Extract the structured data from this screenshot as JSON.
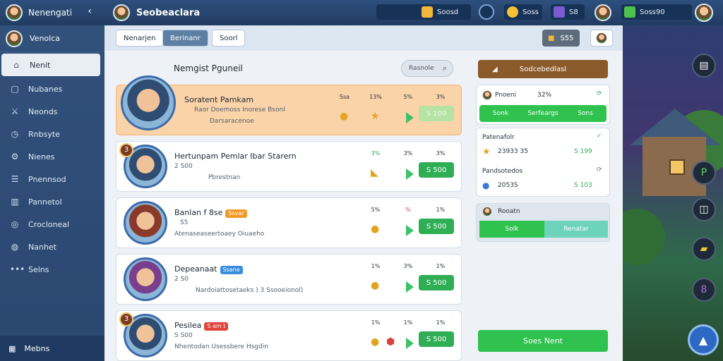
{
  "top": {
    "brand": "Nenengati",
    "collapse": "‹",
    "title": "Seobeaclara",
    "res1": "Soosd",
    "res2": "Soss",
    "res3": "S8",
    "res4": "Soss90"
  },
  "sidebar": {
    "profile": "Venolca",
    "items": [
      {
        "label": "Nenit",
        "icon": "home-icon"
      },
      {
        "label": "Nubanes",
        "icon": "document-icon"
      },
      {
        "label": "Neonds",
        "icon": "sword-icon"
      },
      {
        "label": "Rnbsyte",
        "icon": "clock-icon"
      },
      {
        "label": "Nienes",
        "icon": "cog-icon"
      },
      {
        "label": "Pnennsod",
        "icon": "list-icon"
      },
      {
        "label": "Pannetol",
        "icon": "book-icon"
      },
      {
        "label": "Crocloneal",
        "icon": "stack-icon"
      },
      {
        "label": "Nanhet",
        "icon": "globe-icon"
      },
      {
        "label": "Selns",
        "icon": "more-icon"
      }
    ],
    "bottom": "Mebns"
  },
  "tabs": [
    "Nenarjen",
    "Berinanr",
    "Soorl"
  ],
  "tab_stat": "S55",
  "list": {
    "title": "Nemgist Pguneil",
    "search": "Rasnole"
  },
  "players": [
    {
      "name": "Soratent Pamkam",
      "rank": "",
      "level": "Raor Doemoss Inorese Bsonl",
      "desc": "Darsaracenoe",
      "stats": [
        "Ssa",
        "13%",
        "5%",
        "3%"
      ],
      "price": "S 100",
      "tag": "",
      "featured": true
    },
    {
      "name": "Hertunpam Pemlar Ibar Starern",
      "rank": "3",
      "level": "2 S00",
      "desc": "Pbrestnan",
      "stats": [
        "3%",
        "3%",
        "3%"
      ],
      "price": "S 500",
      "tag": "",
      "featured": false
    },
    {
      "name": "Banlan f 8se",
      "rank": "",
      "level": "S5",
      "desc": "Atenaseaseertoaey Oiuaeho",
      "stats": [
        "5%",
        "%",
        "1%"
      ],
      "price": "S 500",
      "tag": "Ssvar",
      "featured": false
    },
    {
      "name": "Depeanaat",
      "rank": "",
      "level": "2 S0",
      "desc": "Nardoiattosetaeks ) 3 Ssooeionol)",
      "stats": [
        "1%",
        "3%",
        "1%"
      ],
      "price": "S 500",
      "tag": "Ssane",
      "featured": false
    },
    {
      "name": "Pesilea",
      "rank": "3",
      "level": "S S00",
      "desc": "Nhentodan Usessbere Hsgdin",
      "stats": [
        "1%",
        "1%",
        "1%"
      ],
      "price": "S 500",
      "tag": "S am t",
      "featured": false
    }
  ],
  "right": {
    "top_button": "Sodcebedlasl",
    "panel1": {
      "title": "Pnoeni",
      "pct": "32%",
      "segs": [
        "Sonk",
        "Serfeargs",
        "Sons"
      ]
    },
    "panel2": {
      "row1_label": "Patenafolr",
      "row1_value": "23933 35",
      "row1_sub": "S 199",
      "row2_label": "Pandsotedos",
      "row2_value": "2053S",
      "row2_sub": "S 103"
    },
    "panel3": {
      "title": "Rooatn",
      "segs": [
        "Solk",
        "Renatar"
      ]
    },
    "bottom_button": "Soes Nent"
  },
  "colors": {
    "accent_green": "#2fae55",
    "featured_orange": "#fbd3a8",
    "brand_blue": "#2d4f7d"
  }
}
